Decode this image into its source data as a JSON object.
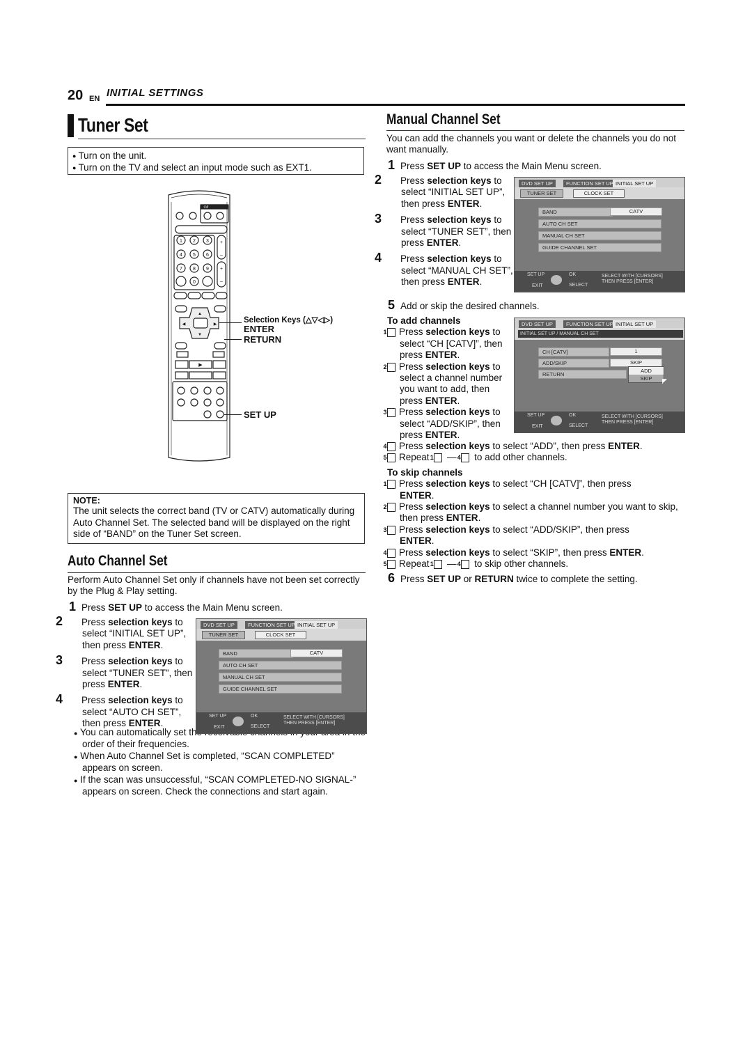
{
  "header": {
    "page_number": "20",
    "language": "EN",
    "section": "INITIAL SETTINGS"
  },
  "tuner_set": {
    "title": "Tuner Set",
    "prep_bullets": [
      "Turn on the unit.",
      "Turn on the TV and select an input mode such as EXT1."
    ],
    "remote_labels": {
      "selection_keys": "Selection Keys (△▽◁▷)",
      "enter": "ENTER",
      "return": "RETURN",
      "setup": "SET UP"
    },
    "remote_keys": {
      "power": "⏻/I",
      "digits": [
        "1",
        "2",
        "3",
        "4",
        "5",
        "6",
        "7",
        "8",
        "9",
        "0"
      ],
      "plus": "+",
      "minus": "–"
    },
    "note": {
      "label": "NOTE:",
      "text": "The unit selects the correct band (TV or CATV) automatically during Auto Channel Set. The selected band will be displayed on the right side of “BAND” on the Tuner Set screen."
    }
  },
  "auto_channel_set": {
    "title": "Auto Channel Set",
    "intro": "Perform Auto Channel Set only if channels have not been set correctly by the Plug & Play setting.",
    "steps": [
      {
        "num": "1",
        "pre": "Press ",
        "bold": "SET UP",
        "post": " to access the Main Menu screen."
      },
      {
        "num": "2",
        "pre": "Press ",
        "bold": "selection keys",
        "post": " to select “INITIAL SET UP”, then press ",
        "bold2": "ENTER",
        "end": "."
      },
      {
        "num": "3",
        "pre": "Press ",
        "bold": "selection keys",
        "post": " to select “TUNER SET”, then press ",
        "bold2": "ENTER",
        "end": "."
      },
      {
        "num": "4",
        "pre": "Press ",
        "bold": "selection keys",
        "post": " to select “AUTO CH SET”, then press ",
        "bold2": "ENTER",
        "end": "."
      }
    ],
    "bullets": [
      "You can automatically set the receivable channels in your area in the order of their frequencies.",
      "When Auto Channel Set is completed, “SCAN COMPLETED” appears on screen.",
      "If the scan was unsuccessful, “SCAN COMPLETED-NO SIGNAL-” appears on screen. Check the connections and start again."
    ]
  },
  "osd_tuner": {
    "tabs": [
      "DVD SET UP",
      "FUNCTION SET UP",
      "INITIAL SET UP"
    ],
    "sub": [
      "TUNER SET",
      "CLOCK SET"
    ],
    "rows": [
      "BAND",
      "AUTO CH SET",
      "MANUAL CH SET",
      "GUIDE CHANNEL SET"
    ],
    "band_value": "CATV",
    "footer": {
      "setup": "SET UP",
      "ok": "OK",
      "exit": "EXIT",
      "select": "SELECT",
      "hint1": "SELECT WITH [CURSORS]",
      "hint2": "THEN PRESS [ENTER]"
    }
  },
  "osd_manual": {
    "tabs": [
      "DVD SET UP",
      "FUNCTION SET UP",
      "INITIAL SET UP"
    ],
    "path": "INITIAL SET UP / MANUAL CH SET",
    "rows": [
      "CH [CATV]",
      "ADD/SKIP",
      "RETURN"
    ],
    "ch_value": "1",
    "addskip_value": "SKIP",
    "popup": [
      "ADD",
      "SKIP"
    ],
    "footer": {
      "setup": "SET UP",
      "ok": "OK",
      "exit": "EXIT",
      "select": "SELECT",
      "hint1": "SELECT WITH [CURSORS]",
      "hint2": "THEN PRESS [ENTER]"
    }
  },
  "manual_channel_set": {
    "title": "Manual Channel Set",
    "intro": "You can add the channels you want or delete the channels you do not want manually.",
    "step1": {
      "num": "1",
      "pre": "Press ",
      "bold": "SET UP",
      "post": " to access the Main Menu screen."
    },
    "steps_side": [
      {
        "num": "2",
        "pre": "Press ",
        "bold": "selection keys",
        "post": " to select “INITIAL SET UP”, then press ",
        "bold2": "ENTER",
        "end": "."
      },
      {
        "num": "3",
        "pre": "Press ",
        "bold": "selection keys",
        "post": " to select “TUNER SET”, then press ",
        "bold2": "ENTER",
        "end": "."
      },
      {
        "num": "4",
        "pre": "Press ",
        "bold": "selection keys",
        "post": " to select “MANUAL CH SET”, then press ",
        "bold2": "ENTER",
        "end": "."
      }
    ],
    "step5": {
      "num": "5",
      "text": "Add or skip the desired channels."
    },
    "add_heading": "To add channels",
    "add_steps": [
      {
        "num": "1",
        "pre": "Press ",
        "bold": "selection keys",
        "post": " to select “CH [CATV]”, then press ",
        "bold2": "ENTER",
        "end": "."
      },
      {
        "num": "2",
        "pre": "Press ",
        "bold": "selection keys",
        "post": " to select a channel number you want to add, then press ",
        "bold2": "ENTER",
        "end": "."
      },
      {
        "num": "3",
        "pre": "Press ",
        "bold": "selection keys",
        "post": " to select “ADD/SKIP”, then press ",
        "bold2": "ENTER",
        "end": "."
      },
      {
        "num": "4",
        "pre": "Press ",
        "bold": "selection keys",
        "post": " to select “ADD”, then press ",
        "bold2": "ENTER",
        "end": "."
      },
      {
        "num": "5",
        "pre": "Repeat ",
        "ref1": "1",
        "mid": " — ",
        "ref2": "4",
        "post": " to add other channels."
      }
    ],
    "skip_heading": "To skip channels",
    "skip_steps": [
      {
        "num": "1",
        "pre": "Press ",
        "bold": "selection keys",
        "post": " to select “CH [CATV]”, then press ",
        "bold2": "ENTER",
        "end": "."
      },
      {
        "num": "2",
        "pre": "Press ",
        "bold": "selection keys",
        "post": " to select a channel number you want to skip, then press ",
        "bold2": "ENTER",
        "end": "."
      },
      {
        "num": "3",
        "pre": "Press ",
        "bold": "selection keys",
        "post": " to select “ADD/SKIP”, then press ",
        "bold2": "ENTER",
        "end": "."
      },
      {
        "num": "4",
        "pre": "Press ",
        "bold": "selection keys",
        "post": " to select “SKIP”, then press ",
        "bold2": "ENTER",
        "end": "."
      },
      {
        "num": "5",
        "pre": "Repeat ",
        "ref1": "1",
        "mid": " — ",
        "ref2": "4",
        "post": " to skip other channels."
      }
    ],
    "step6": {
      "num": "6",
      "pre": "Press ",
      "bold": "SET UP",
      "mid": " or ",
      "bold2": "RETURN",
      "post": " twice to complete the setting."
    }
  }
}
